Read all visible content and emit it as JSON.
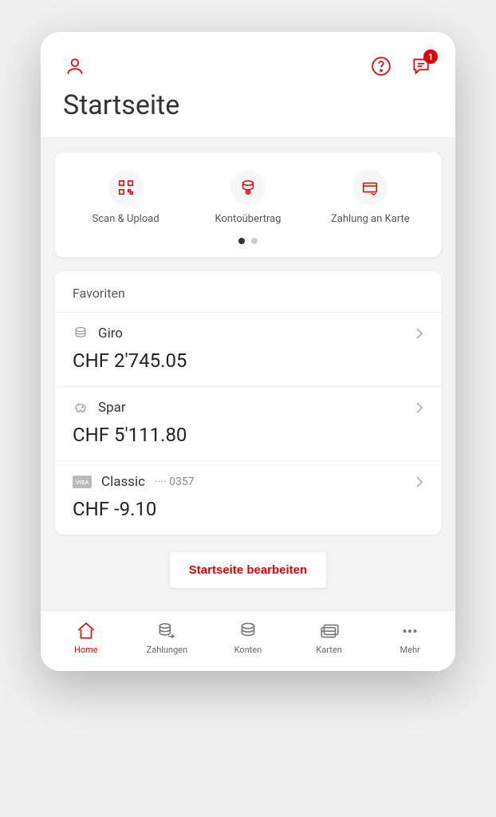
{
  "colors": {
    "accent": "#e60000"
  },
  "header": {
    "notification_count": "1"
  },
  "title": "Startseite",
  "actions": [
    {
      "label": "Scan & Upload",
      "icon": "qr"
    },
    {
      "label": "Kontoübertrag",
      "icon": "transfer"
    },
    {
      "label": "Zahlung an Karte",
      "icon": "card-payment"
    }
  ],
  "favorites": {
    "heading": "Favoriten",
    "items": [
      {
        "name": "Giro",
        "sub": "",
        "amount": "CHF 2'745.05",
        "icon": "coins"
      },
      {
        "name": "Spar",
        "sub": "",
        "amount": "CHF 5'111.80",
        "icon": "piggy"
      },
      {
        "name": "Classic",
        "sub": "···· 0357",
        "amount": "CHF -9.10",
        "icon": "visa"
      }
    ]
  },
  "edit_button": "Startseite bearbeiten",
  "tabs": [
    {
      "label": "Home",
      "active": true
    },
    {
      "label": "Zahlungen",
      "active": false
    },
    {
      "label": "Konten",
      "active": false
    },
    {
      "label": "Karten",
      "active": false
    },
    {
      "label": "Mehr",
      "active": false
    }
  ]
}
